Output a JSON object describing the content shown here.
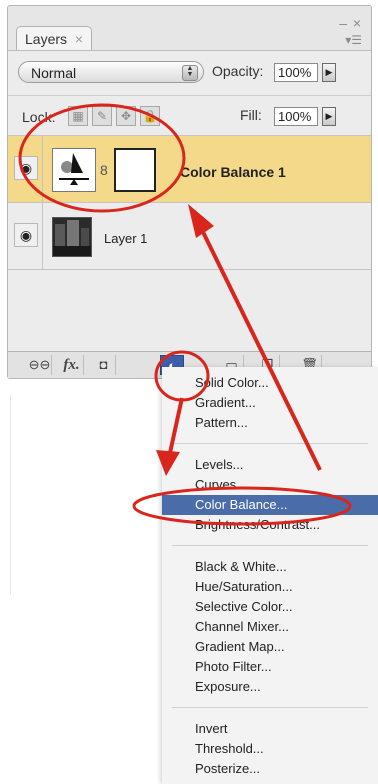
{
  "panel": {
    "tab_label": "Layers",
    "tab_close": "×",
    "blend_mode": "Normal",
    "opacity_label": "Opacity:",
    "opacity_value": "100%",
    "lock_label": "Lock:",
    "fill_label": "Fill:",
    "fill_value": "100%",
    "layers": [
      {
        "name": "Color Balance 1",
        "selected": true
      },
      {
        "name": "Layer 1",
        "selected": false
      }
    ],
    "toolbar_fx": "fx."
  },
  "menu": {
    "groups": [
      [
        "Solid Color...",
        "Gradient...",
        "Pattern..."
      ],
      [
        "Levels...",
        "Curves...",
        "Color Balance...",
        "Brightness/Contrast..."
      ],
      [
        "Black & White...",
        "Hue/Saturation...",
        "Selective Color...",
        "Channel Mixer...",
        "Gradient Map...",
        "Photo Filter...",
        "Exposure..."
      ],
      [
        "Invert",
        "Threshold...",
        "Posterize..."
      ]
    ],
    "highlighted": "Color Balance..."
  },
  "colors": {
    "selected_row": "#f5d98a",
    "menu_highlight": "#4a6ca8",
    "annotation": "#d9261c"
  }
}
